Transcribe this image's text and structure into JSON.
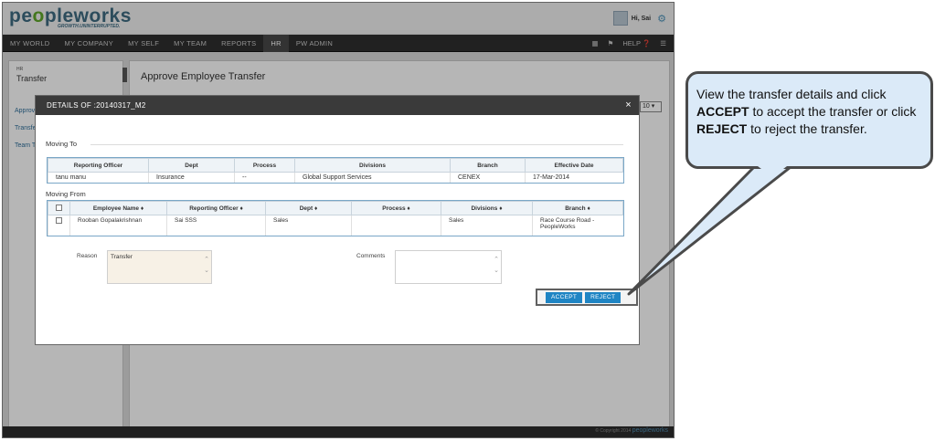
{
  "header": {
    "logo_main": "pe",
    "logo_accent": "o",
    "logo_rest": "pleworks",
    "tagline": "GROWTH.UNINTERRUPTED.",
    "user_greeting": "Hi, Sai"
  },
  "nav": {
    "items": [
      "MY WORLD",
      "MY COMPANY",
      "MY SELF",
      "MY TEAM",
      "REPORTS",
      "HR",
      "PW ADMIN"
    ],
    "active": "HR",
    "help_label": "HELP"
  },
  "left_panel": {
    "section": "HR",
    "title": "Transfer",
    "links": [
      "Approv",
      "Transfe",
      "Team T"
    ]
  },
  "main": {
    "title": "Approve Employee Transfer",
    "page_size": "10"
  },
  "modal": {
    "title": "DETAILS OF :20140317_M2",
    "moving_to_label": "Moving To",
    "moving_to_headers": [
      "Reporting Officer",
      "Dept",
      "Process",
      "Divisions",
      "Branch",
      "Effective Date"
    ],
    "moving_to_row": [
      "tanu manu",
      "Insurance",
      "--",
      "Global Support Services",
      "CENEX",
      "17-Mar-2014"
    ],
    "moving_from_label": "Moving From",
    "moving_from_headers": [
      "Employee Name",
      "Reporting Officer",
      "Dept",
      "Process",
      "Divisions",
      "Branch"
    ],
    "moving_from_row": [
      "Rooban Gopalakrishnan",
      "Sai SSS",
      "Sales",
      "",
      "Sales",
      "Race Course Road - PeopleWorks"
    ],
    "reason_label": "Reason",
    "reason_value": "Transfer",
    "comments_label": "Comments",
    "comments_value": "",
    "accept_label": "ACCEPT",
    "reject_label": "REJECT"
  },
  "footer": {
    "copyright": "© Copyright 2014",
    "brand": "peopleworks"
  },
  "callout": {
    "line1": "View the transfer details and click",
    "accept_word": "ACCEPT",
    "line2": " to accept the transfer or click ",
    "reject_word": "REJECT",
    "line3": " to reject the transfer."
  },
  "colors": {
    "accent_blue": "#1f85c4",
    "nav_bg": "#2f2f2f",
    "callout_bg": "#dbeaf8",
    "logo_green": "#5ea52a",
    "logo_blue": "#3d6a80"
  }
}
